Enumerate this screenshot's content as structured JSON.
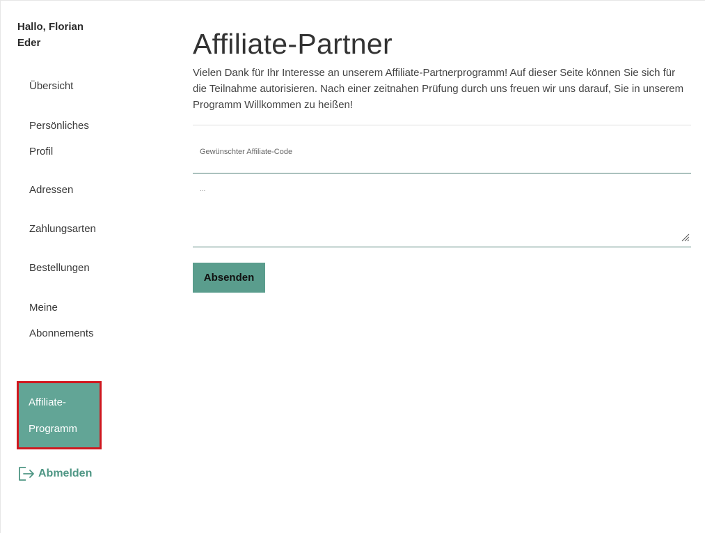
{
  "sidebar": {
    "greeting": "Hallo, Florian Eder",
    "items": [
      {
        "label": "Übersicht"
      },
      {
        "label": "Persönliches Profil"
      },
      {
        "label": "Adressen"
      },
      {
        "label": "Zahlungsarten"
      },
      {
        "label": "Bestellungen"
      },
      {
        "label": "Meine Abonnements"
      },
      {
        "label": "Affiliate-Programm",
        "active": true
      }
    ],
    "logout_label": "Abmelden",
    "logout_icon": "logout-icon"
  },
  "main": {
    "title": "Affiliate-Partner",
    "intro": "Vielen Dank für Ihr Interesse an unserem Affiliate-Partnerprogramm! Auf dieser Seite können Sie sich für die Teilnahme autorisieren. Nach einer zeitnahen Prüfung durch uns freuen wir uns darauf, Sie in unserem Programm Willkommen zu heißen!",
    "code_field_label": "Gewünschter Affiliate-Code",
    "textarea_placeholder": "...",
    "submit_label": "Absenden"
  },
  "colors": {
    "accent": "#62a596",
    "active_outline": "#d0181f",
    "logout_text": "#4e9684"
  }
}
